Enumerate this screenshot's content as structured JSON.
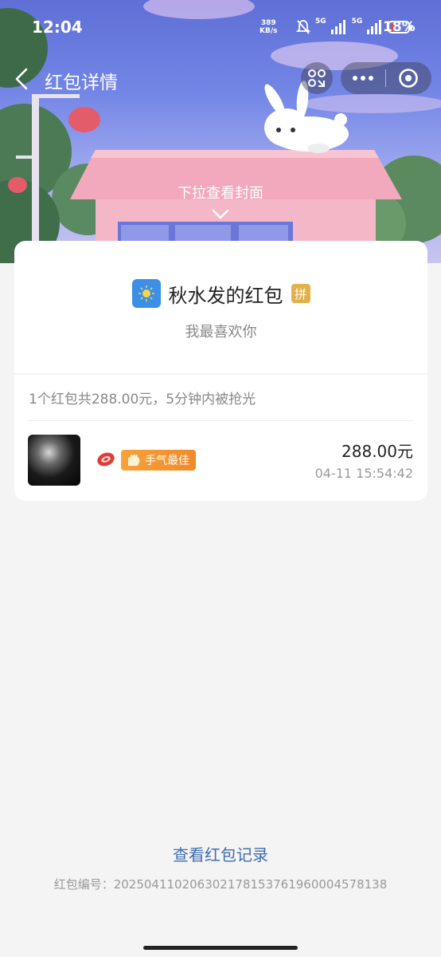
{
  "status_bar": {
    "time": "12:04",
    "net_speed_value": "389",
    "net_speed_unit": "KB/s",
    "signal1_label": "5G",
    "signal2_label": "5G",
    "battery_pct": "18%"
  },
  "nav": {
    "title": "红包详情"
  },
  "cover": {
    "pull_hint": "下拉查看封面"
  },
  "card": {
    "sender_name": "秋水发的红包",
    "pin_badge": "拼",
    "blessing": "我最喜欢你",
    "summary": "1个红包共288.00元，5分钟内被抢光"
  },
  "receivers": [
    {
      "tag": "手气最佳",
      "amount": "288.00元",
      "time": "04-11 15:54:42"
    }
  ],
  "footer": {
    "records_link": "查看红包记录",
    "serial": "红包编号：20250411020630217815376196000457813​8"
  },
  "colors": {
    "link": "#3f6db0",
    "best_tag": "#f08a2a",
    "pin_badge": "#e2b14a",
    "sender_avatar": "#3b8fe6"
  }
}
